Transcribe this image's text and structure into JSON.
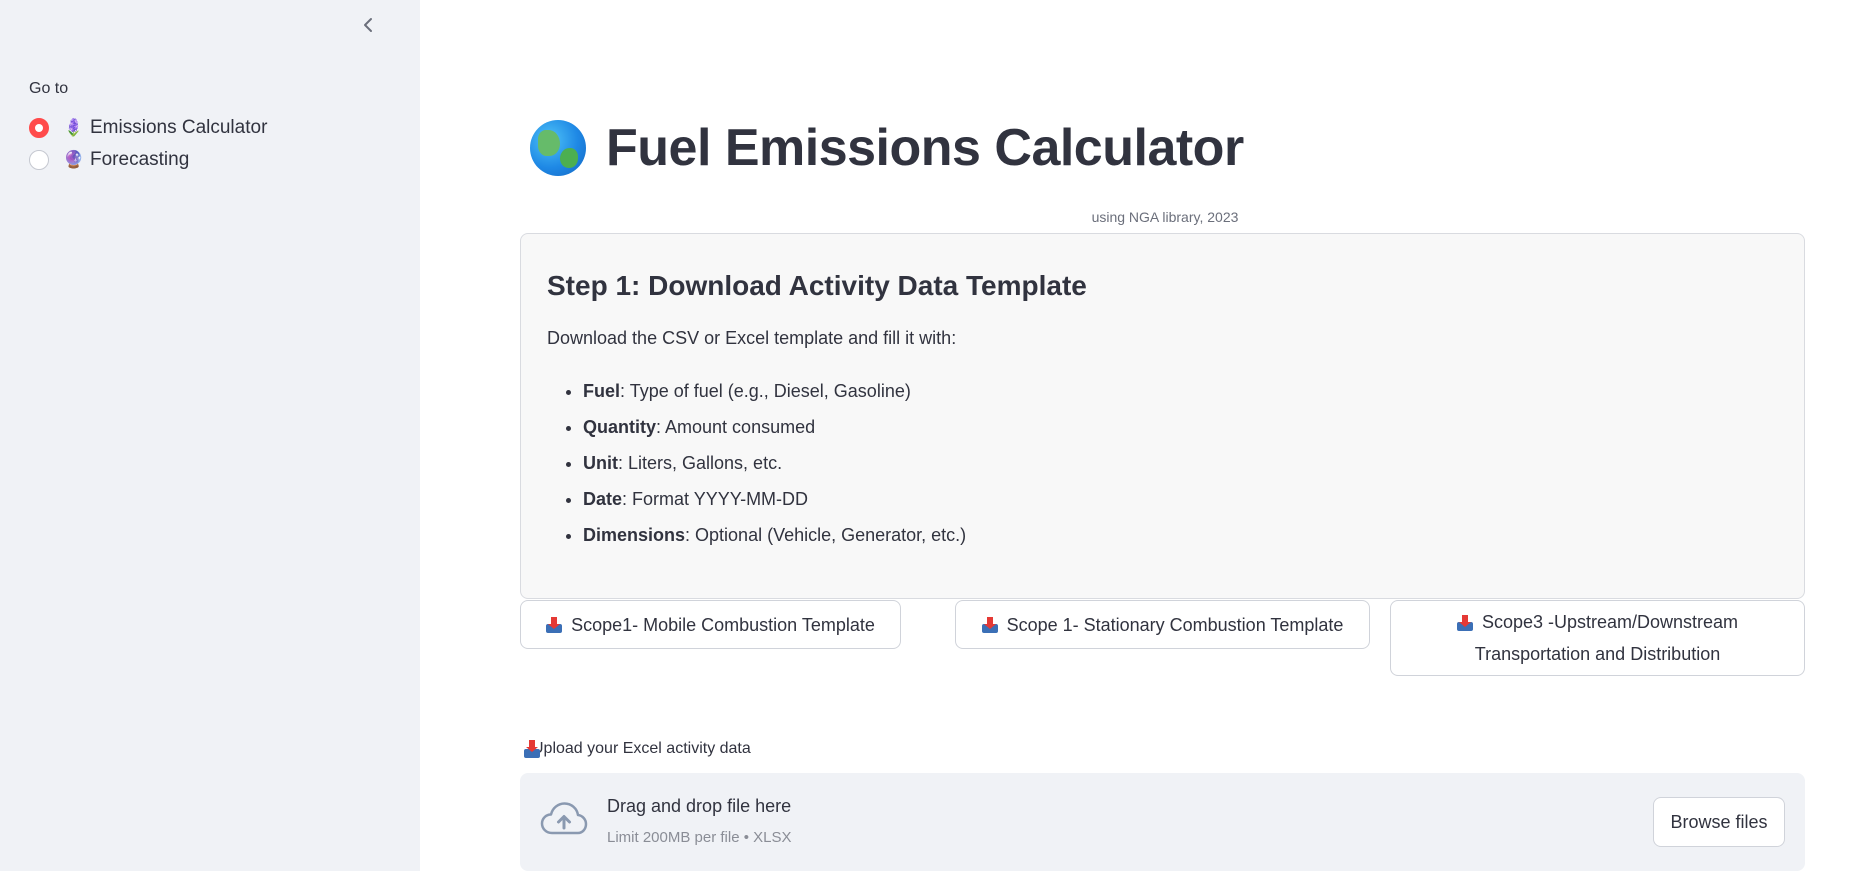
{
  "sidebar": {
    "collapse_icon": "chevron-left-icon",
    "goto_label": "Go to",
    "options": [
      {
        "emoji": "🪻",
        "label": "Emissions Calculator",
        "selected": true
      },
      {
        "emoji": "🔮",
        "label": "Forecasting",
        "selected": false
      }
    ]
  },
  "main": {
    "title_icon": "globe-icon",
    "title": "Fuel Emissions Calculator",
    "subtitle": "using NGA library, 2023",
    "step1": {
      "heading": "Step 1: Download Activity Data Template",
      "description": "Download the CSV or Excel template and fill it with:",
      "items": [
        {
          "term": "Fuel",
          "text": ": Type of fuel (e.g., Diesel, Gasoline)"
        },
        {
          "term": "Quantity",
          "text": ": Amount consumed"
        },
        {
          "term": "Unit",
          "text": ": Liters, Gallons, etc."
        },
        {
          "term": "Date",
          "text": ": Format YYYY-MM-DD"
        },
        {
          "term": "Dimensions",
          "text": ": Optional (Vehicle, Generator, etc.)"
        }
      ]
    },
    "download_buttons": [
      {
        "label": "Scope1- Mobile Combustion Template"
      },
      {
        "label": "Scope 1- Stationary Combustion Template"
      },
      {
        "label": "Scope3 -Upstream/Downstream Transportation and Distribution"
      }
    ],
    "upload": {
      "label": "Upload your Excel activity data",
      "drag_text": "Drag and drop file here",
      "limit_text": "Limit 200MB per file • XLSX",
      "browse_label": "Browse files"
    }
  },
  "colors": {
    "accent": "#ff4b4b",
    "sidebar_bg": "#f0f2f6",
    "text": "#31333f"
  }
}
